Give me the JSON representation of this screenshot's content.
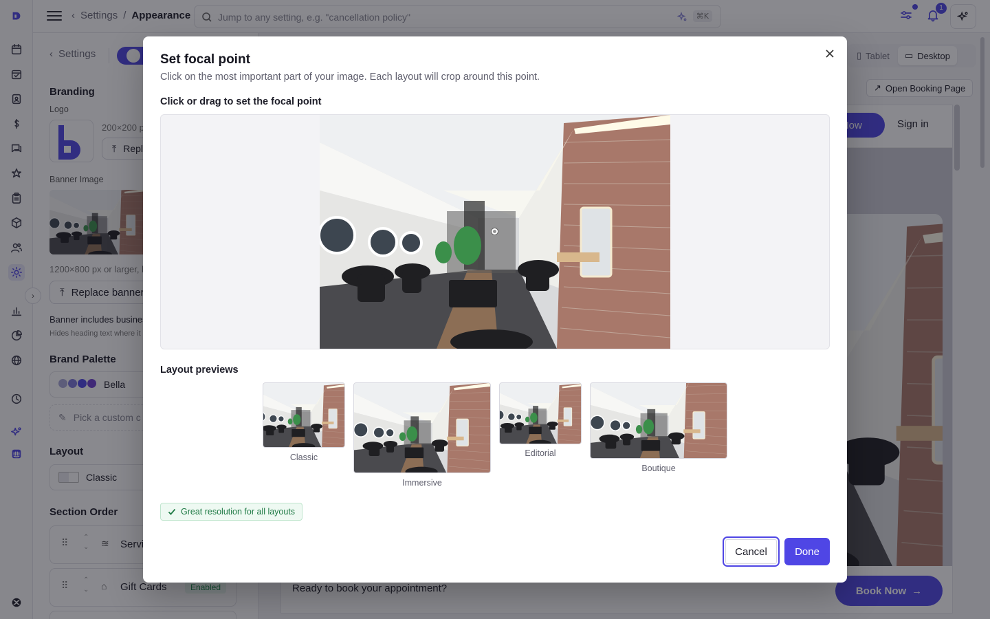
{
  "topbar": {
    "breadcrumb_parent": "Settings",
    "breadcrumb_separator": "/",
    "breadcrumb_current": "Appearance",
    "search_placeholder": "Jump to any setting, e.g. \"cancellation policy\"",
    "search_shortcut": "⌘K",
    "notification_count": "1"
  },
  "settings_panel": {
    "back_label": "Settings",
    "branding_heading": "Branding",
    "logo_label": "Logo",
    "logo_size_hint": "200×200 p",
    "replace_logo_label": "Repla",
    "banner_label": "Banner Image",
    "banner_size_hint": "1200×800 px or larger, la",
    "replace_banner_label": "Replace banner",
    "banner_includes_label": "Banner includes busines",
    "banner_includes_hint": "Hides heading text where it o",
    "palette_heading": "Brand Palette",
    "palette_name": "Bella",
    "palette_swatches": [
      "#a7a6d6",
      "#7b76d9",
      "#4f46e5",
      "#6c3fd0"
    ],
    "custom_color_label": "Pick a custom c",
    "layout_heading": "Layout",
    "layout_value": "Classic",
    "section_order_heading": "Section Order",
    "sections": [
      {
        "label": "Servi",
        "status": ""
      },
      {
        "label": "Gift Cards",
        "status": "Enabled"
      }
    ]
  },
  "preview": {
    "device_tablet": "Tablet",
    "device_desktop": "Desktop",
    "open_booking_page": "Open Booking Page",
    "book_now_top": "k Now",
    "sign_in": "Sign in",
    "cta_text": "Ready to book your appointment?",
    "cta_button": "Book Now"
  },
  "modal": {
    "title": "Set focal point",
    "subtitle": "Click on the most important part of your image. Each layout will crop around this point.",
    "focal_label": "Click or drag to set the focal point",
    "previews_label": "Layout previews",
    "layouts": [
      {
        "name": "Classic"
      },
      {
        "name": "Immersive"
      },
      {
        "name": "Editorial"
      },
      {
        "name": "Boutique"
      }
    ],
    "resolution_note": "Great resolution for all layouts",
    "cancel_label": "Cancel",
    "done_label": "Done"
  },
  "colors": {
    "accent": "#4f46e5",
    "success": "#1f7a45"
  }
}
